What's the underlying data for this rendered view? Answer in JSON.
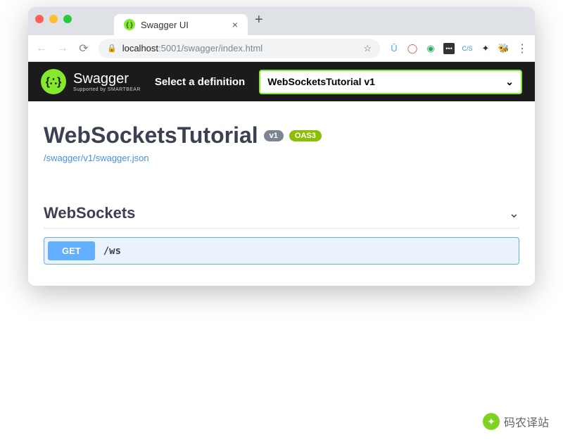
{
  "browser": {
    "tab_title": "Swagger UI",
    "url_host": "localhost",
    "url_port": ":5001",
    "url_path": "/swagger/index.html"
  },
  "topbar": {
    "logo_name": "Swagger",
    "logo_sub": "Supported by SMARTBEAR",
    "select_label": "Select a definition",
    "selected_definition": "WebSocketsTutorial v1"
  },
  "info": {
    "title": "WebSocketsTutorial",
    "version_badge": "v1",
    "oas_badge": "OAS3",
    "json_link": "/swagger/v1/swagger.json"
  },
  "tag": {
    "name": "WebSockets"
  },
  "operation": {
    "method": "GET",
    "path": "/ws"
  },
  "watermark": {
    "text": "码农译站"
  }
}
